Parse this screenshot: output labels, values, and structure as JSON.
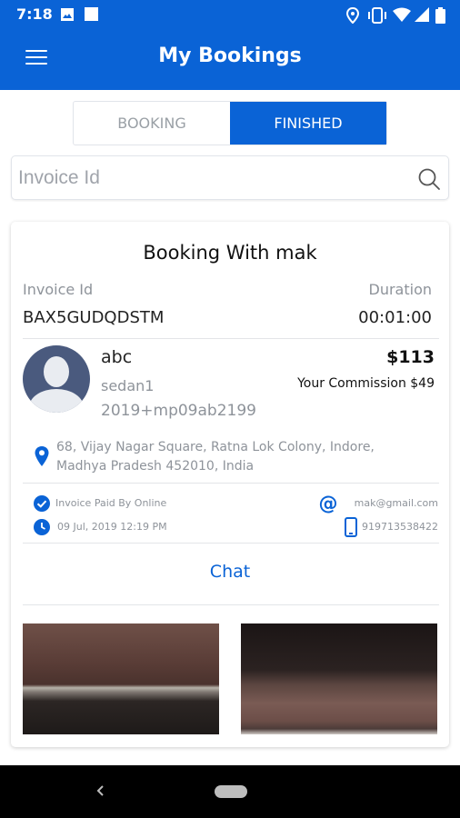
{
  "status_bar": {
    "time": "7:18",
    "icons": [
      "image-icon",
      "square-icon",
      "location-icon",
      "vibrate-icon",
      "wifi-icon",
      "signal-icon",
      "battery-icon"
    ]
  },
  "app_bar": {
    "title": "My Bookings",
    "menu_icon": "hamburger-menu-icon",
    "color": "#0a63d6"
  },
  "tabs": [
    {
      "label": "BOOKING",
      "active": false
    },
    {
      "label": "FINISHED",
      "active": true
    }
  ],
  "search": {
    "placeholder": "Invoice Id",
    "value": ""
  },
  "booking_card": {
    "title": "Booking With mak",
    "invoice_label": "Invoice Id",
    "invoice_value": "BAX5GUDQDSTM",
    "duration_label": "Duration",
    "duration_value": "00:01:00",
    "customer_name": "abc",
    "car_type": "sedan1",
    "plate": "2019+mp09ab2199",
    "amount": "$113",
    "commission": "Your Commission $49",
    "address": "68, Vijay Nagar Square, Ratna Lok Colony, Indore, Madhya Pradesh 452010, India",
    "payment_status": "Invoice Paid By Online",
    "email": "mak@gmail.com",
    "date": "09 Jul, 2019 12:19 PM",
    "phone": "919713538422",
    "chat_label": "Chat"
  },
  "nav_bar": {
    "icons": [
      "back-icon",
      "home-pill-icon"
    ]
  }
}
